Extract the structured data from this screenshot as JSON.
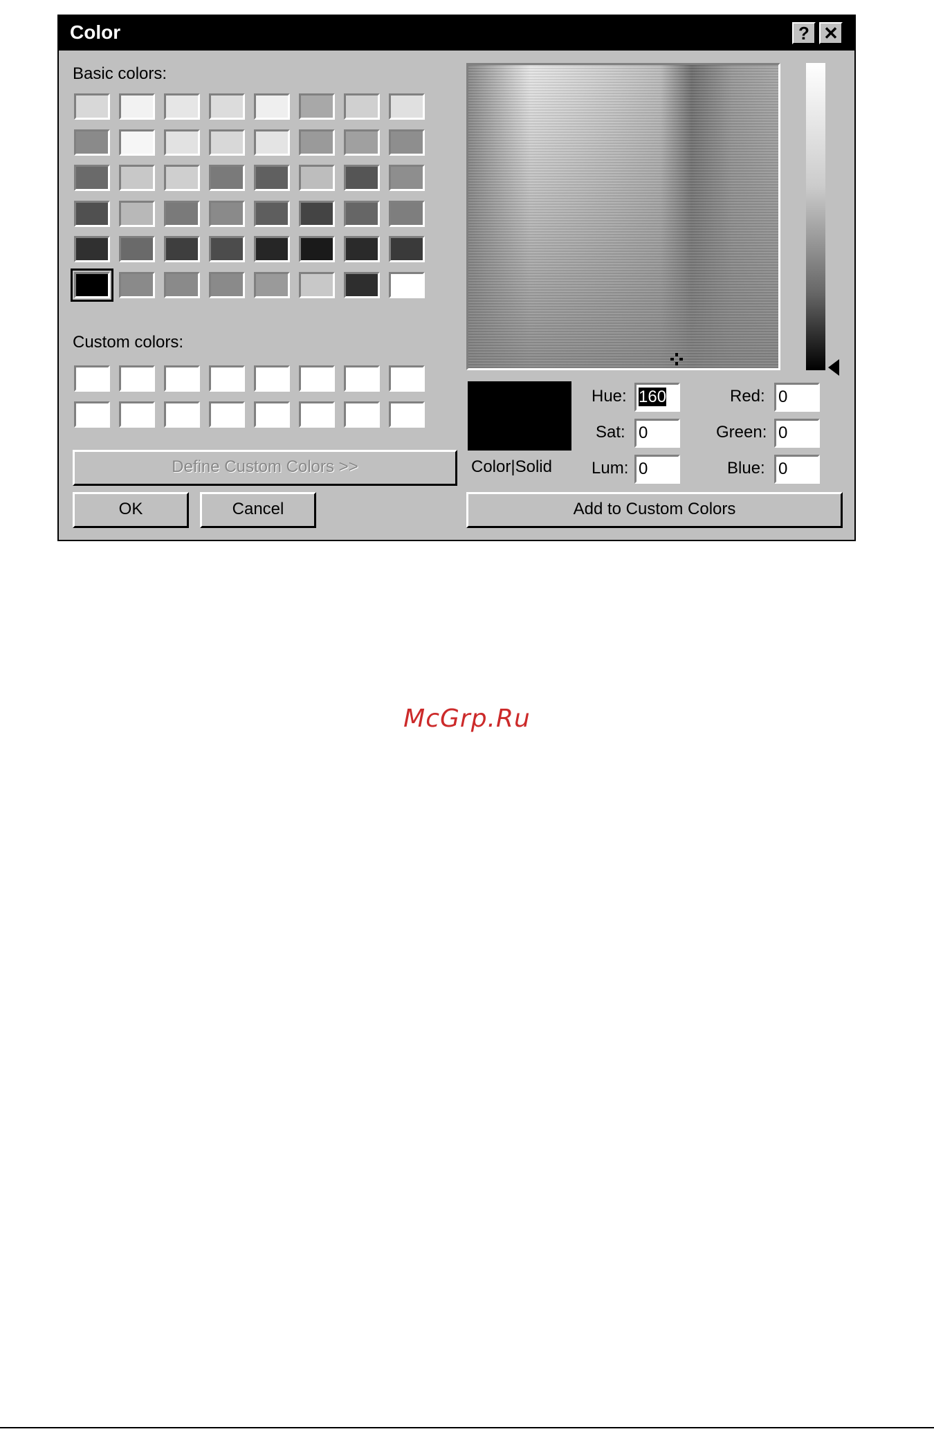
{
  "dialog": {
    "title": "Color",
    "help_button": "?",
    "close_button": "✕"
  },
  "basic_colors": {
    "label": "Basic colors:",
    "rows": [
      [
        "#d8d8d8",
        "#f2f2f2",
        "#e6e6e6",
        "#dcdcdc",
        "#efefef",
        "#a8a8a8",
        "#d0d0d0",
        "#e0e0e0"
      ],
      [
        "#8a8a8a",
        "#f6f6f6",
        "#e2e2e2",
        "#d8d8d8",
        "#e4e4e4",
        "#9a9a9a",
        "#a0a0a0",
        "#8e8e8e"
      ],
      [
        "#6a6a6a",
        "#c8c8c8",
        "#cfcfcf",
        "#7a7a7a",
        "#606060",
        "#bdbdbd",
        "#555555",
        "#8e8e8e"
      ],
      [
        "#505050",
        "#b8b8b8",
        "#7a7a7a",
        "#8a8a8a",
        "#5e5e5e",
        "#444444",
        "#666666",
        "#7e7e7e"
      ],
      [
        "#303030",
        "#6a6a6a",
        "#3e3e3e",
        "#4c4c4c",
        "#262626",
        "#1a1a1a",
        "#2a2a2a",
        "#3a3a3a"
      ],
      [
        "#000000",
        "#8a8a8a",
        "#8a8a8a",
        "#8a8a8a",
        "#9a9a9a",
        "#c8c8c8",
        "#2e2e2e",
        "#ffffff"
      ]
    ]
  },
  "custom_colors": {
    "label": "Custom colors:",
    "rows": [
      [
        "#ffffff",
        "#ffffff",
        "#ffffff",
        "#ffffff",
        "#ffffff",
        "#ffffff",
        "#ffffff",
        "#ffffff"
      ],
      [
        "#ffffff",
        "#ffffff",
        "#ffffff",
        "#ffffff",
        "#ffffff",
        "#ffffff",
        "#ffffff",
        "#ffffff"
      ]
    ]
  },
  "buttons": {
    "define_custom": "Define Custom Colors >>",
    "ok": "OK",
    "cancel": "Cancel",
    "add_custom": "Add to Custom Colors"
  },
  "preview": {
    "label": "Color|Solid",
    "color": "#000000"
  },
  "fields": {
    "hue": {
      "label": "Hue:",
      "value": "160"
    },
    "sat": {
      "label": "Sat:",
      "value": "0"
    },
    "lum": {
      "label": "Lum:",
      "value": "0"
    },
    "red": {
      "label": "Red:",
      "value": "0"
    },
    "green": {
      "label": "Green:",
      "value": "0"
    },
    "blue": {
      "label": "Blue:",
      "value": "0"
    }
  },
  "watermark": "McGrp.Ru"
}
